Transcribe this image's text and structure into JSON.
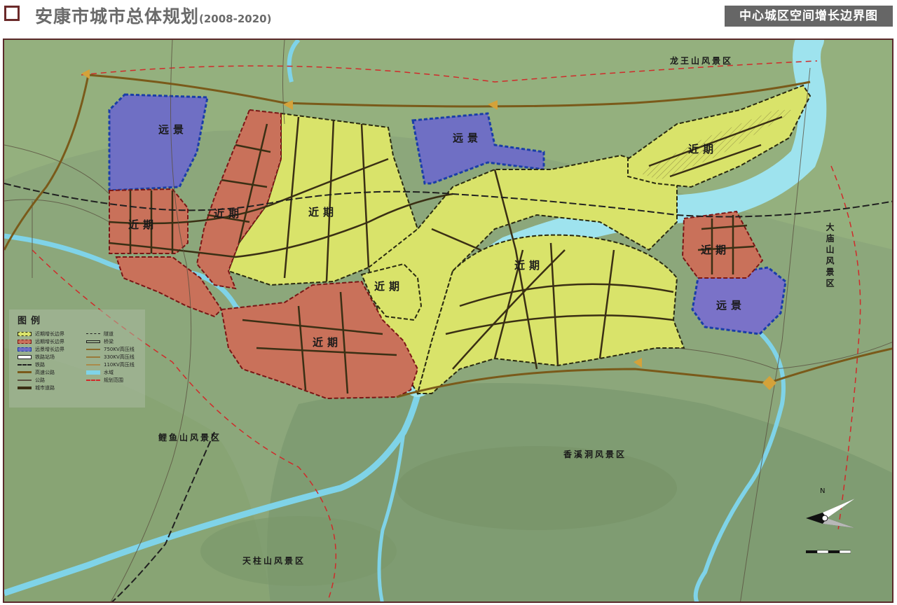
{
  "header": {
    "title": "安康市城市总体规划",
    "year": "(2008-2020)",
    "subtitle": "中心城区空间增长边界图"
  },
  "colors": {
    "near_term": "#d9e36a",
    "long_term_red": "#c9715a",
    "far_future": "#6f6fc4",
    "river": "#7fd3e8",
    "terrain": "#8ca77b"
  },
  "zones": {
    "far_nw": "远景",
    "far_n": "远景",
    "far_e": "远景",
    "near_main": "近期",
    "near_red_a": "近期",
    "near_red_b": "近期",
    "near_red_c": "近期",
    "near_small": "近期",
    "near_south_bank": "近期",
    "near_ne": "近期",
    "near_east": "近期"
  },
  "scenic_areas": {
    "longwang": "龙王山风景区",
    "damiao": "大庙山风景区",
    "liyu": "鲤鱼山风景区",
    "xiangxi": "香溪洞风景区",
    "tianzhu": "天柱山风景区"
  },
  "legend": {
    "title": "图例",
    "left_items": [
      "近期增长边界",
      "远期增长边界",
      "远景增长边界",
      "铁路站场",
      "铁路",
      "高速公路",
      "公路",
      "城市道路"
    ],
    "right_items": [
      "隧道",
      "桥梁",
      "750KV高压线",
      "330KV高压线",
      "110KV高压线",
      "水域",
      "规划范围"
    ]
  }
}
